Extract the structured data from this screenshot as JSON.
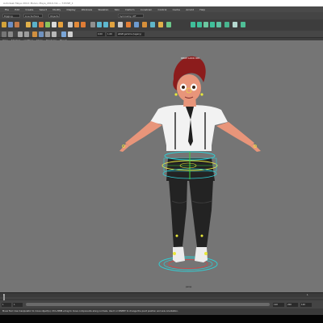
{
  "app": {
    "window_title": "Autodesk Maya 2019: Mulan, Maya_2019.mb --- T-POSE_1"
  },
  "menubar": {
    "items": [
      "File",
      "Edit",
      "Create",
      "Select",
      "Modify",
      "Display",
      "Windows",
      "Skeleton",
      "Skin",
      "Deform",
      "Constrain",
      "Control",
      "Cache",
      "Arnold",
      "Help"
    ]
  },
  "modebar": {
    "workspace": "Rigging",
    "selection_mask": "Live Surface",
    "search_placeholder": "Symmetry: Off",
    "channel": "Objects"
  },
  "panel": {
    "menus": [
      "View",
      "Shading",
      "Lighting",
      "Show",
      "Renderer",
      "Panels"
    ],
    "exposure": "0.00",
    "gamma": "1.00",
    "colorspace": "sRGB gamma (legacy)"
  },
  "viewport": {
    "hud_label": "ORRT LOCK ON",
    "camera_label": "persp"
  },
  "timeline": {
    "start": "1",
    "end": "120",
    "current": "1",
    "range_start": "1",
    "range_end": "120",
    "range_out": "200"
  },
  "helpline": {
    "text": "Move Tool: Use manipulator to move object(s). Ctrl+MMB+drag to move components along normals. Use D or INSERT to change the pivot position and axis orientation."
  },
  "colors": {
    "viewport_bg": "#757575",
    "skin": "#e8957a",
    "hair": "#8c1c1c",
    "shirt": "#f2f2f2",
    "pants": "#232323",
    "rig_cyan": "#2fd0d6",
    "rig_yellow": "#e8e83a"
  }
}
